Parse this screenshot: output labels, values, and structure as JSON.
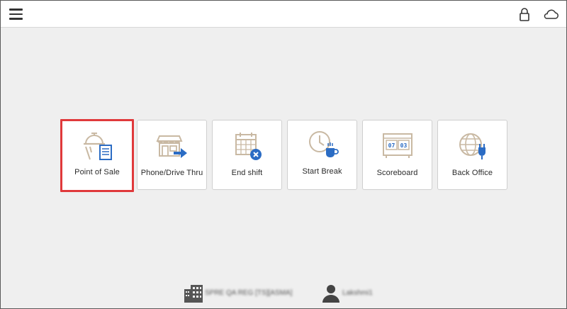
{
  "header": {
    "menu_icon": "hamburger-menu-icon",
    "lock_icon": "lock-icon",
    "cloud_icon": "cloud-icon"
  },
  "tiles": [
    {
      "label": "Point of Sale",
      "icon": "point-of-sale-icon",
      "selected": true
    },
    {
      "label": "Phone/Drive Thru",
      "icon": "phone-drive-thru-icon",
      "selected": false
    },
    {
      "label": "End shift",
      "icon": "end-shift-icon",
      "selected": false
    },
    {
      "label": "Start Break",
      "icon": "start-break-icon",
      "selected": false
    },
    {
      "label": "Scoreboard",
      "icon": "scoreboard-icon",
      "selected": false,
      "digits": [
        "07",
        "03"
      ]
    },
    {
      "label": "Back Office",
      "icon": "back-office-icon",
      "selected": false
    }
  ],
  "footer": {
    "store": "SPRE QA REG [TS][ASMA]",
    "user": "Lakshmi1",
    "store_icon": "building-icon",
    "user_icon": "user-icon"
  },
  "colors": {
    "selection_border": "#e0393b",
    "icon_tan": "#c9b9a3",
    "icon_blue": "#2b6cc4"
  }
}
